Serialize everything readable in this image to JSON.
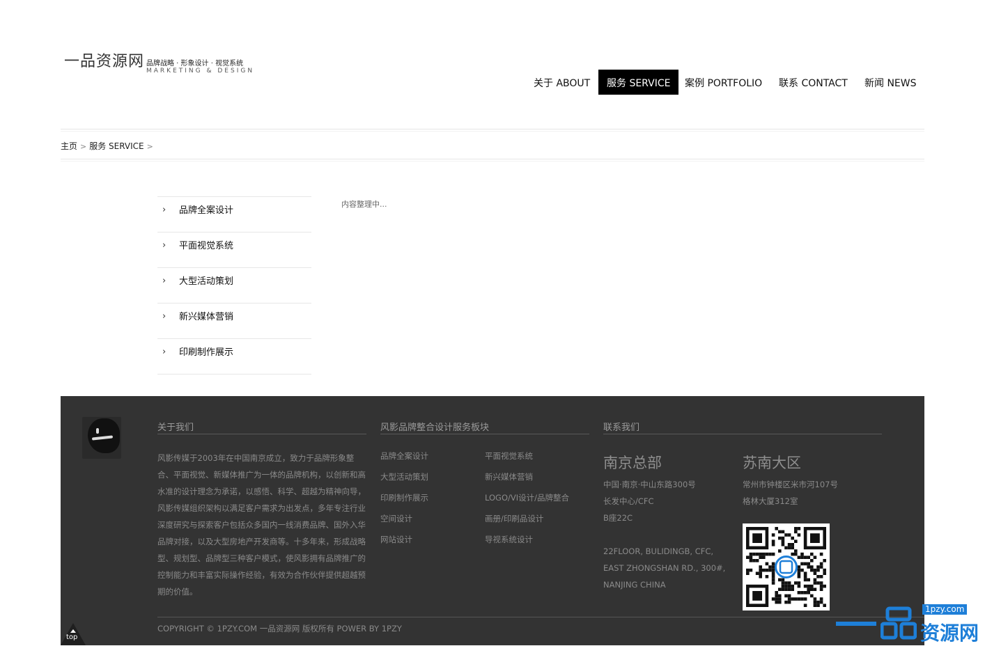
{
  "header": {
    "logo_cn": "一品资源网",
    "logo_tagline": "品牌战略 · 形象设计 · 视觉系统",
    "logo_en": "MARKETING & DESIGN",
    "nav": [
      {
        "label": "关于 ABOUT",
        "active": false
      },
      {
        "label": "服务 SERVICE",
        "active": true
      },
      {
        "label": "案例 PORTFOLIO",
        "active": false
      },
      {
        "label": "联系 CONTACT",
        "active": false
      },
      {
        "label": "新闻 NEWS",
        "active": false
      }
    ]
  },
  "breadcrumb": {
    "home": "主页",
    "current": "服务 SERVICE",
    "separator": ">"
  },
  "sidebar": {
    "chevron": "›",
    "items": [
      {
        "label": "品牌全案设计"
      },
      {
        "label": "平面视觉系统"
      },
      {
        "label": "大型活动策划"
      },
      {
        "label": "新兴媒体营销"
      },
      {
        "label": "印刷制作展示"
      }
    ]
  },
  "main": {
    "content": "内容整理中..."
  },
  "footer": {
    "about": {
      "title": "关于我们",
      "text": "风影传媒于2003年在中国南京成立，致力于品牌形象整合、平面视觉、新媒体推广为一体的品牌机构，以创新和高水准的设计理念为承诺，以感悟、科学、超越为精神向导，风影传媒组织架构以满足客户需求为出发点，多年专注行业深度研究与探索客户包括众多国内一线消费品牌、国外入华品牌对接，以及大型房地产开发商等。十多年来，形成战略型、规划型、品牌型三种客户模式，使风影拥有品牌推广的控制能力和丰富实际操作经验，有效为合作伙伴提供超越预期的价值。"
    },
    "services": {
      "title": "风影品牌整合设计服务板块",
      "col1": [
        "品牌全案设计",
        "大型活动策划",
        "印刷制作展示",
        "空间设计",
        "网站设计"
      ],
      "col2": [
        "平面视觉系统",
        "新兴媒体营销",
        "LOGO/VI设计/品牌整合",
        "画册/印刷品设计",
        "导视系统设计"
      ]
    },
    "contact": {
      "title": "联系我们",
      "hq": {
        "city": "南京总部",
        "lines": [
          "中国·南京·中山东路300号",
          "长发中心/CFC",
          "B座22C"
        ],
        "en_lines": [
          "22FLOOR, BULIDINGB, CFC,",
          "EAST ZHONGSHAN RD., 300#,",
          "NANJING CHINA"
        ]
      },
      "branch": {
        "city": "苏南大区",
        "lines": [
          "常州市钟楼区米市河107号",
          "格林大厦312室"
        ]
      },
      "qr_icon": "qr-code-icon"
    },
    "copyright": "COPYRIGHT © 1PZY.COM 一品资源网 版权所有 POWER BY 1PZY",
    "top_label": "top"
  },
  "watermark": {
    "domain": "1pzy.com",
    "brand": "资源网"
  },
  "colors": {
    "footer_bg": "#333333",
    "nav_active_bg": "#000000",
    "watermark_blue": "#1e7fd8"
  }
}
